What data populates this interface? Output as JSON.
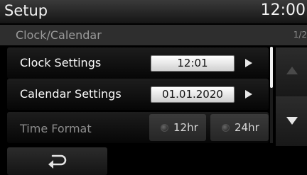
{
  "header": {
    "title": "Setup",
    "time": "12:00"
  },
  "subheader": {
    "title": "Clock/Calendar",
    "page": "1/2"
  },
  "rows": [
    {
      "label": "Clock Settings",
      "value": "12:01"
    },
    {
      "label": "Calendar Settings",
      "value": "01.01.2020"
    },
    {
      "label": "Time Format",
      "options": [
        "12hr",
        "24hr"
      ]
    }
  ],
  "icons": {
    "back": "back-arrow-icon",
    "scroll_up": "up-triangle-icon",
    "scroll_down": "down-triangle-icon",
    "row_arrow": "right-triangle-icon"
  }
}
